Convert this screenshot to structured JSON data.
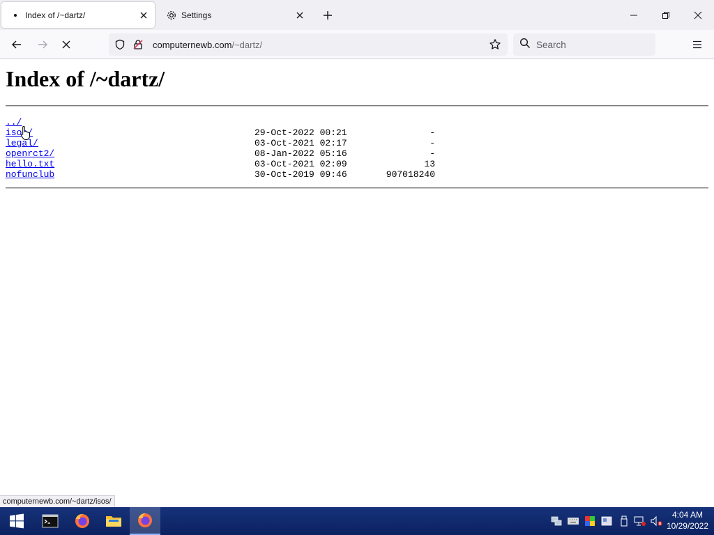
{
  "browser": {
    "tabs": [
      {
        "title": "Index of /~dartz/",
        "active": true
      },
      {
        "title": "Settings",
        "active": false
      }
    ],
    "url": {
      "host": "computernewb.com",
      "path": "/~dartz/"
    },
    "search_placeholder": "Search"
  },
  "page": {
    "heading": "Index of /~dartz/",
    "entries": [
      {
        "name": "../",
        "date": "",
        "size": ""
      },
      {
        "name": "isos/",
        "date": "29-Oct-2022 00:21",
        "size": "-"
      },
      {
        "name": "legal/",
        "date": "03-Oct-2021 02:17",
        "size": "-"
      },
      {
        "name": "openrct2/",
        "date": "08-Jan-2022 05:16",
        "size": "-"
      },
      {
        "name": "hello.txt",
        "date": "03-Oct-2021 02:09",
        "size": "13"
      },
      {
        "name": "nofunclub",
        "date": "30-Oct-2019 09:46",
        "size": "907018240"
      }
    ]
  },
  "status_link": "computernewb.com/~dartz/isos/",
  "taskbar": {
    "apps": [
      "start-icon",
      "terminal-icon",
      "firefox-icon",
      "file-explorer-icon",
      "firefox-icon"
    ],
    "tray": [
      "network-icon",
      "keyboard-icon",
      "color-icon",
      "display-icon",
      "usb-icon",
      "network-error-icon",
      "volume-muted-icon"
    ],
    "time": "4:04 AM",
    "date": "10/29/2022"
  },
  "colors": {
    "link": "#0000ee",
    "taskbar": "#16327a",
    "tab_strip": "#f0f0f4"
  }
}
